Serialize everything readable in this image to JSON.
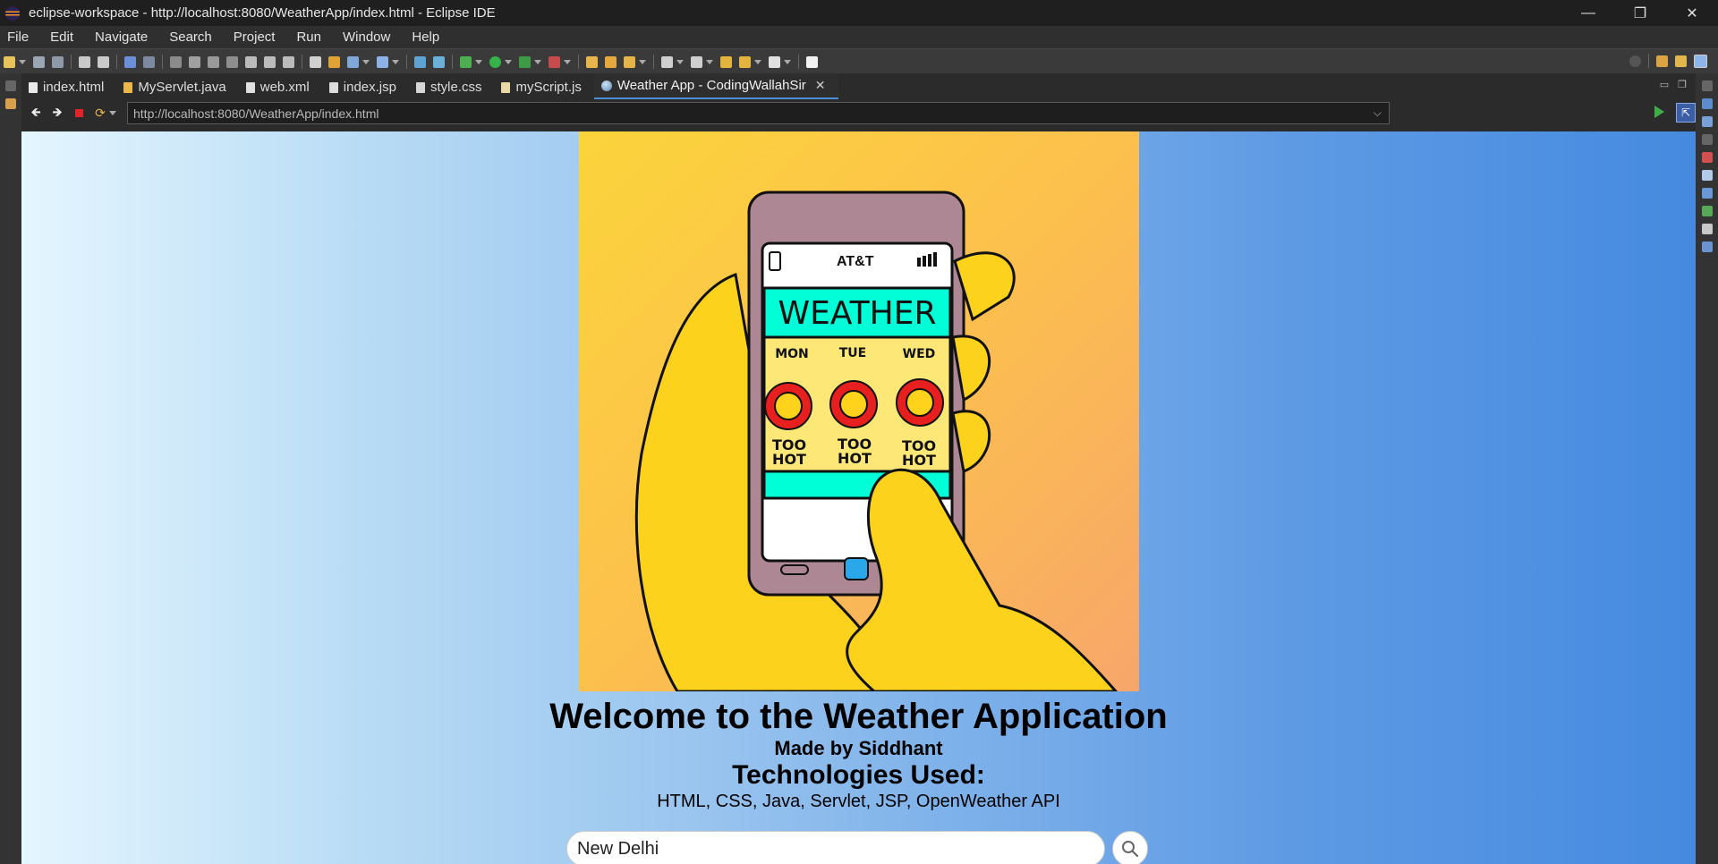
{
  "window": {
    "title": "eclipse-workspace - http://localhost:8080/WeatherApp/index.html - Eclipse IDE",
    "controls": [
      "—",
      "❐",
      "✕"
    ]
  },
  "menubar": {
    "items": [
      "File",
      "Edit",
      "Navigate",
      "Search",
      "Project",
      "Run",
      "Window",
      "Help"
    ]
  },
  "editor_tabs": [
    {
      "label": "index.html",
      "icon": "html-file-icon",
      "active": false
    },
    {
      "label": "MyServlet.java",
      "icon": "java-file-icon",
      "active": false
    },
    {
      "label": "web.xml",
      "icon": "xml-file-icon",
      "active": false
    },
    {
      "label": "index.jsp",
      "icon": "jsp-file-icon",
      "active": false
    },
    {
      "label": "style.css",
      "icon": "css-file-icon",
      "active": false
    },
    {
      "label": "myScript.js",
      "icon": "js-file-icon",
      "active": false
    },
    {
      "label": "Weather App - CodingWallahSir",
      "icon": "globe-icon",
      "active": true
    }
  ],
  "browser": {
    "url": "http://localhost:8080/WeatherApp/index.html"
  },
  "page": {
    "hero_image": {
      "carrier": "AT&T",
      "app_title": "WEATHER",
      "days": [
        "MON",
        "TUE",
        "WED"
      ],
      "forecast_line1": "TOO",
      "forecast_line2": "HOT"
    },
    "welcome": "Welcome to the Weather Application",
    "made_by": "Made by Siddhant",
    "tech_heading": "Technologies Used:",
    "tech_list": "HTML, CSS, Java, Servlet, JSP, OpenWeather API",
    "search": {
      "value": "New Delhi"
    }
  },
  "colors": {
    "gradient_start": "#e4f6ff",
    "gradient_end": "#458ae0",
    "active_tab_underline": "#4d8fd6",
    "phone_screen_header": "#00ffd6",
    "sun": "#e81f1f"
  }
}
